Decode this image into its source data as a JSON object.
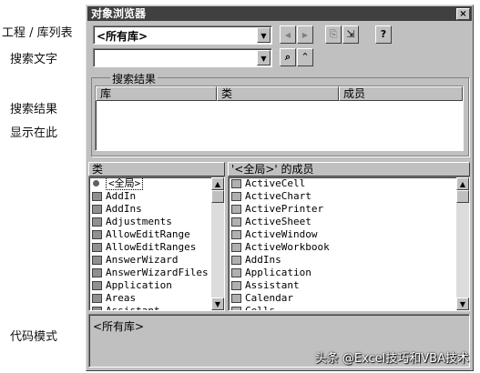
{
  "annotations": {
    "project_library": "工程 / 库列表",
    "search_text": "搜索文字",
    "search_results_1": "搜索结果",
    "search_results_2": "显示在此",
    "code_mode": "代码模式"
  },
  "window": {
    "title": "对象浏览器",
    "close_label": "×"
  },
  "toolbar": {
    "library_value": "<所有库>",
    "search_value": "",
    "nav_back": "◀",
    "nav_forward": "▶",
    "copy_label": "⎘",
    "view_def_label": "⇲",
    "help_label": "?",
    "search_btn_label": "⌕",
    "toggle_label": "⌃"
  },
  "search_results": {
    "group_title": "搜索结果",
    "columns": [
      "库",
      "类",
      "成员"
    ]
  },
  "classes_pane": {
    "header": "类",
    "items": [
      "<全局>",
      "AddIn",
      "AddIns",
      "Adjustments",
      "AllowEditRange",
      "AllowEditRanges",
      "AnswerWizard",
      "AnswerWizardFiles",
      "Application",
      "Areas",
      "Assistant"
    ]
  },
  "members_pane": {
    "header": "'<全局>' 的成员",
    "items": [
      "ActiveCell",
      "ActiveChart",
      "ActivePrinter",
      "ActiveSheet",
      "ActiveWindow",
      "ActiveWorkbook",
      "AddIns",
      "Application",
      "Assistant",
      "Calendar",
      "Cells"
    ]
  },
  "details": {
    "text": "<所有库>"
  },
  "watermark": "头条 @Excel技巧和VBA技术"
}
